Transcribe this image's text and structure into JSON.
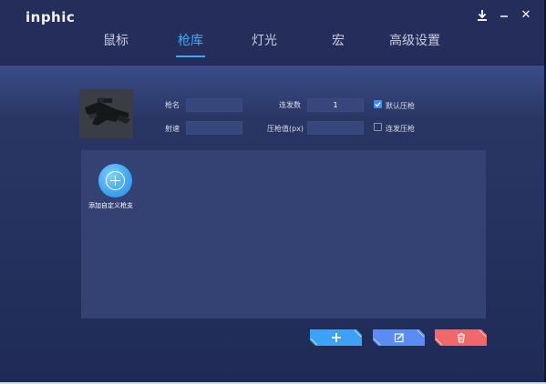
{
  "app": {
    "logo": "inphic"
  },
  "window_controls": {
    "download_icon": "download-icon",
    "minimize_icon": "minimize-icon",
    "close_icon": "close-icon",
    "close_glyph": "✕"
  },
  "tabs": [
    {
      "label": "鼠标",
      "active": false
    },
    {
      "label": "枪库",
      "active": true
    },
    {
      "label": "灯光",
      "active": false
    },
    {
      "label": "宏",
      "active": false
    },
    {
      "label": "高级设置",
      "active": false
    }
  ],
  "form": {
    "gun_name_label": "枪名",
    "gun_name_value": "",
    "fire_rate_label": "射速",
    "fire_rate_value": "",
    "burst_count_label": "连发数",
    "burst_count_value": "1",
    "recoil_label": "压枪值(px)",
    "recoil_value": "",
    "default_recoil_label": "默认压枪",
    "default_recoil_checked": true,
    "burst_recoil_label": "连发压枪",
    "burst_recoil_checked": false
  },
  "panel": {
    "add_custom_label": "添加自定义枪支"
  },
  "actions": {
    "add_color": "#3da2f5",
    "edit_color": "#5b8cf3",
    "delete_color": "#f0686a"
  },
  "colors": {
    "accent": "#41a8ff",
    "window_bg": "#283563",
    "panel_bg": "#334272"
  }
}
